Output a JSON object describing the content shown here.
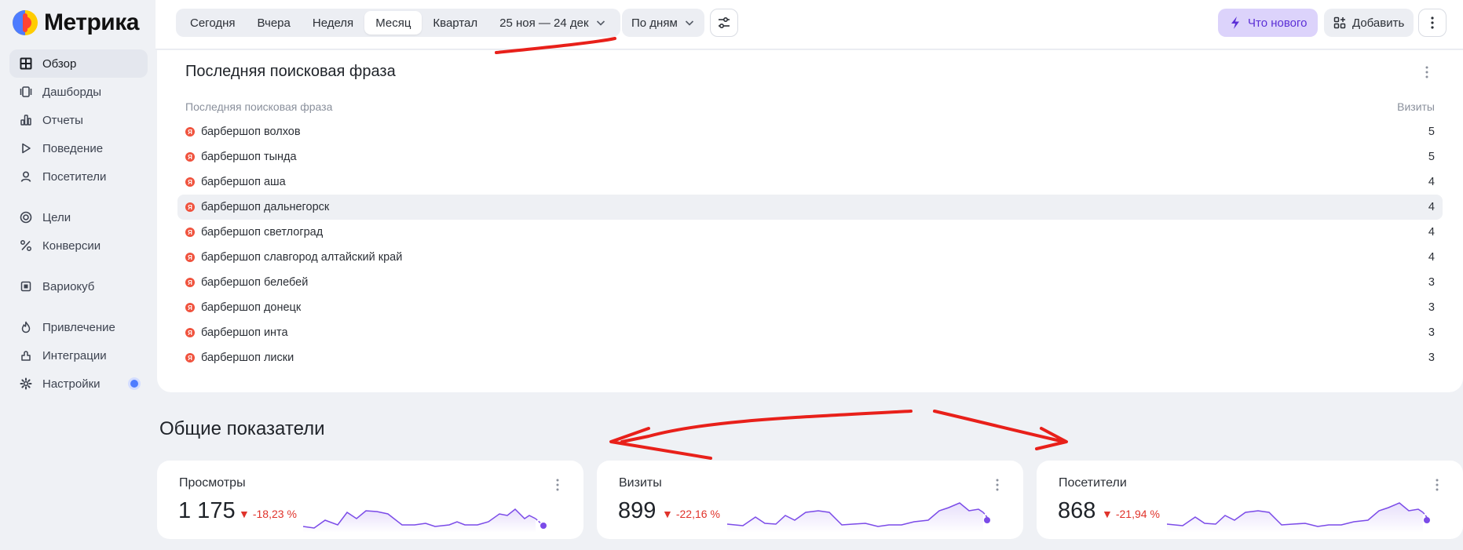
{
  "app": {
    "name": "Метрика"
  },
  "sidebar": {
    "items": [
      {
        "label": "Обзор",
        "icon": "grid-icon",
        "active": true
      },
      {
        "label": "Дашборды",
        "icon": "dashboards-icon"
      },
      {
        "label": "Отчеты",
        "icon": "bar-chart-icon"
      },
      {
        "label": "Поведение",
        "icon": "play-icon"
      },
      {
        "label": "Посетители",
        "icon": "user-icon"
      },
      {
        "label": "Цели",
        "icon": "target-icon"
      },
      {
        "label": "Конверсии",
        "icon": "percent-icon"
      },
      {
        "label": "Вариокуб",
        "icon": "cube-icon"
      },
      {
        "label": "Привлечение",
        "icon": "flame-icon"
      },
      {
        "label": "Интеграции",
        "icon": "plug-icon"
      },
      {
        "label": "Настройки",
        "icon": "gear-icon"
      }
    ]
  },
  "topbar": {
    "periods": [
      "Сегодня",
      "Вчера",
      "Неделя",
      "Месяц",
      "Квартал"
    ],
    "active_period": "Месяц",
    "date_range": "25 ноя — 24 дек",
    "group_by": "По дням",
    "whats_new": "Что нового",
    "add": "Добавить"
  },
  "search_card": {
    "title": "Последняя поисковая фраза",
    "col_phrase": "Последняя поисковая фраза",
    "col_visits": "Визиты",
    "rows": [
      {
        "phrase": "барбершоп волхов",
        "visits": "5"
      },
      {
        "phrase": "барбершоп тында",
        "visits": "5"
      },
      {
        "phrase": "барбершоп аша",
        "visits": "4"
      },
      {
        "phrase": "барбершоп дальнегорск",
        "visits": "4"
      },
      {
        "phrase": "барбершоп светлоград",
        "visits": "4"
      },
      {
        "phrase": "барбершоп славгород алтайский край",
        "visits": "4"
      },
      {
        "phrase": "барбершоп белебей",
        "visits": "3"
      },
      {
        "phrase": "барбершоп донецк",
        "visits": "3"
      },
      {
        "phrase": "барбершоп инта",
        "visits": "3"
      },
      {
        "phrase": "барбершоп лиски",
        "visits": "3"
      }
    ]
  },
  "overview": {
    "title": "Общие показатели",
    "metrics": [
      {
        "title": "Просмотры",
        "value": "1 175",
        "delta": "-18,23 %"
      },
      {
        "title": "Визиты",
        "value": "899",
        "delta": "-22,16 %"
      },
      {
        "title": "Посетители",
        "value": "868",
        "delta": "-21,94 %"
      }
    ]
  },
  "colors": {
    "accent": "#7b4be8",
    "negative": "#e0332b",
    "annotation": "#e8201a",
    "yandex_red": "#f0533e"
  }
}
